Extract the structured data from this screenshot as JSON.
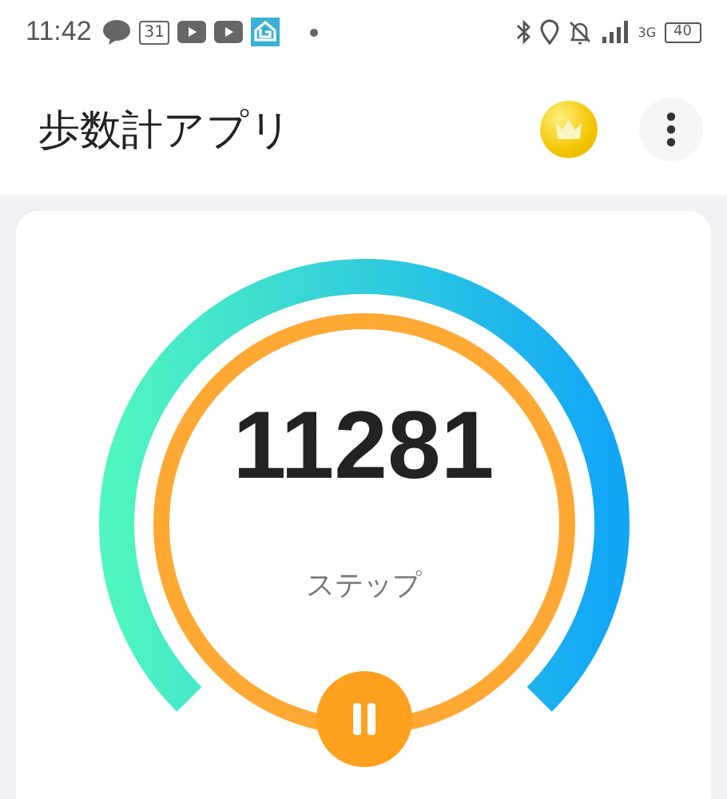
{
  "status_bar": {
    "time": "11:42",
    "calendar_day": "31",
    "network": "3G",
    "battery": "40"
  },
  "app_bar": {
    "title": "歩数計アプリ"
  },
  "step_counter": {
    "steps": "11281",
    "unit": "ステップ"
  }
}
